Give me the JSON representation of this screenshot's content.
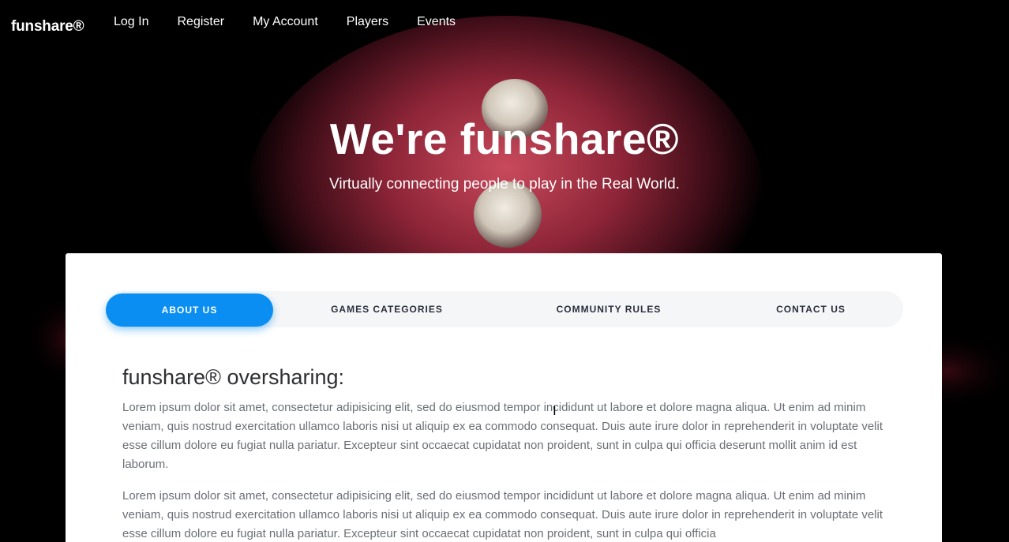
{
  "nav": {
    "brand": "funshare®",
    "links": [
      "Log In",
      "Register",
      "My Account",
      "Players",
      "Events"
    ]
  },
  "hero": {
    "title": "We're funshare®",
    "subtitle": "Virtually connecting people to play in the Real World."
  },
  "tabs": [
    {
      "label": "ABOUT US",
      "active": true
    },
    {
      "label": "GAMES CATEGORIES",
      "active": false
    },
    {
      "label": "COMMUNITY RULES",
      "active": false
    },
    {
      "label": "CONTACT US",
      "active": false
    }
  ],
  "content": {
    "heading": "funshare® oversharing:",
    "paragraphs": [
      "Lorem ipsum dolor sit amet, consectetur adipisicing elit, sed do eiusmod tempor incididunt ut labore et dolore magna aliqua. Ut enim ad minim veniam, quis nostrud exercitation ullamco laboris nisi ut aliquip ex ea commodo consequat. Duis aute irure dolor in reprehenderit in voluptate velit esse cillum dolore eu fugiat nulla pariatur. Excepteur sint occaecat cupidatat non proident, sunt in culpa qui officia deserunt mollit anim id est laborum.",
      "Lorem ipsum dolor sit amet, consectetur adipisicing elit, sed do eiusmod tempor incididunt ut labore et dolore magna aliqua. Ut enim ad minim veniam, quis nostrud exercitation ullamco laboris nisi ut aliquip ex ea commodo consequat. Duis aute irure dolor in reprehenderit in voluptate velit esse cillum dolore eu fugiat nulla pariatur. Excepteur sint occaecat cupidatat non proident, sunt in culpa qui officia"
    ]
  },
  "colors": {
    "accent": "#0a8ef2",
    "hero_bg": "#000000",
    "card_bg": "#ffffff",
    "tab_bar_bg": "#f5f6f8",
    "text_dark": "#2d2f33",
    "text_body": "#6b6f75"
  },
  "icons": {
    "cursor": "text-cursor-icon"
  }
}
